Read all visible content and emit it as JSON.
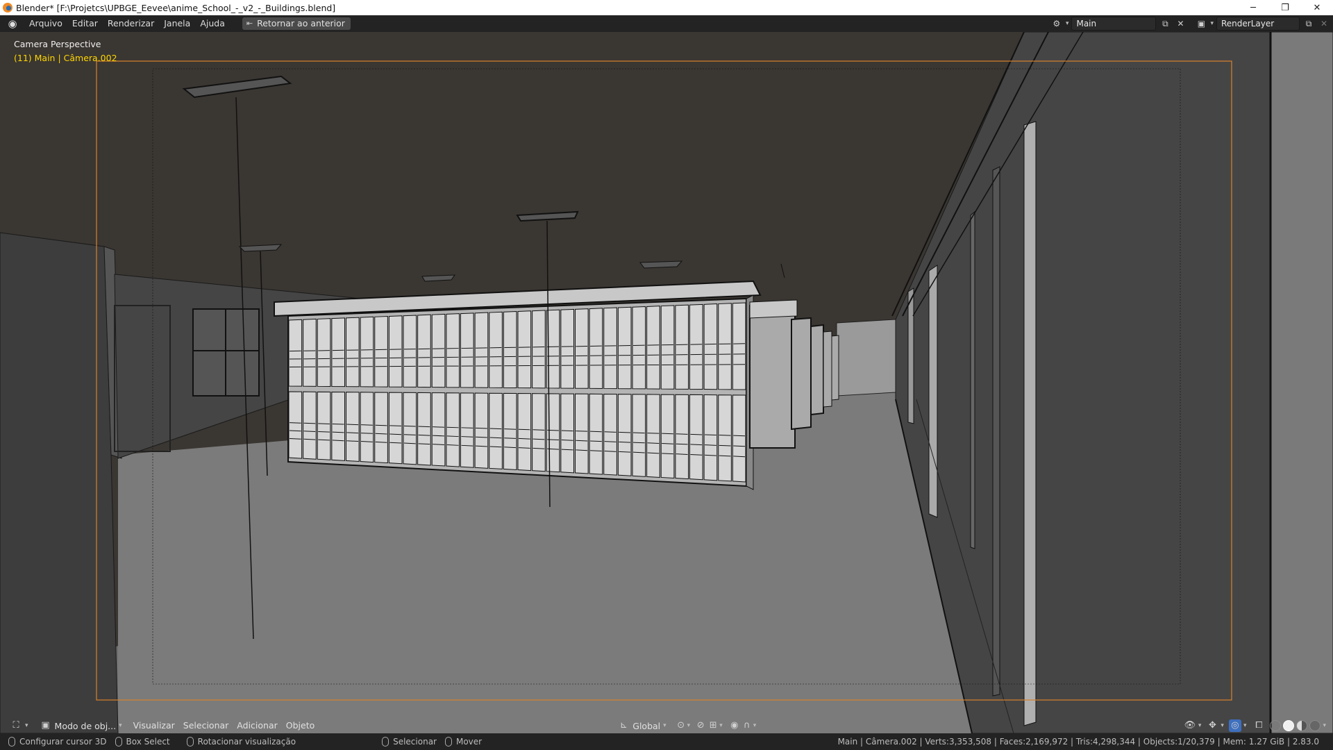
{
  "window": {
    "title": "Blender* [F:\\Projetcs\\UPBGE_Eevee\\anime_School_-_v2_-_Buildings.blend]",
    "minimize": "─",
    "restore": "❐",
    "close": "✕"
  },
  "menu": {
    "items": [
      "Arquivo",
      "Editar",
      "Renderizar",
      "Janela",
      "Ajuda"
    ],
    "back_button": "Retornar ao anterior"
  },
  "scene": {
    "name": "Main",
    "view_layer": "RenderLayer"
  },
  "viewport": {
    "view_name": "Camera Perspective",
    "object_info": "(11) Main | Câmera.002",
    "colors": {
      "background": "#3a3632",
      "floor": "#7a7a7a",
      "camera_frame": "#d9822b",
      "object_info": "#ffd700"
    }
  },
  "header": {
    "mode": "Modo de obj...",
    "menus": [
      "Visualizar",
      "Selecionar",
      "Adicionar",
      "Objeto"
    ],
    "orientation": "Global"
  },
  "status": {
    "hints": [
      {
        "label": "Configurar cursor 3D"
      },
      {
        "label": "Box Select"
      },
      {
        "label": "Rotacionar visualização"
      },
      {
        "label": "Selecionar"
      },
      {
        "label": "Mover"
      }
    ],
    "stats": "Main | Câmera.002 | Verts:3,353,508 | Faces:2,169,972 | Tris:4,298,344 | Objects:1/20,379 | Mem: 1.27 GiB | 2.83.0"
  }
}
